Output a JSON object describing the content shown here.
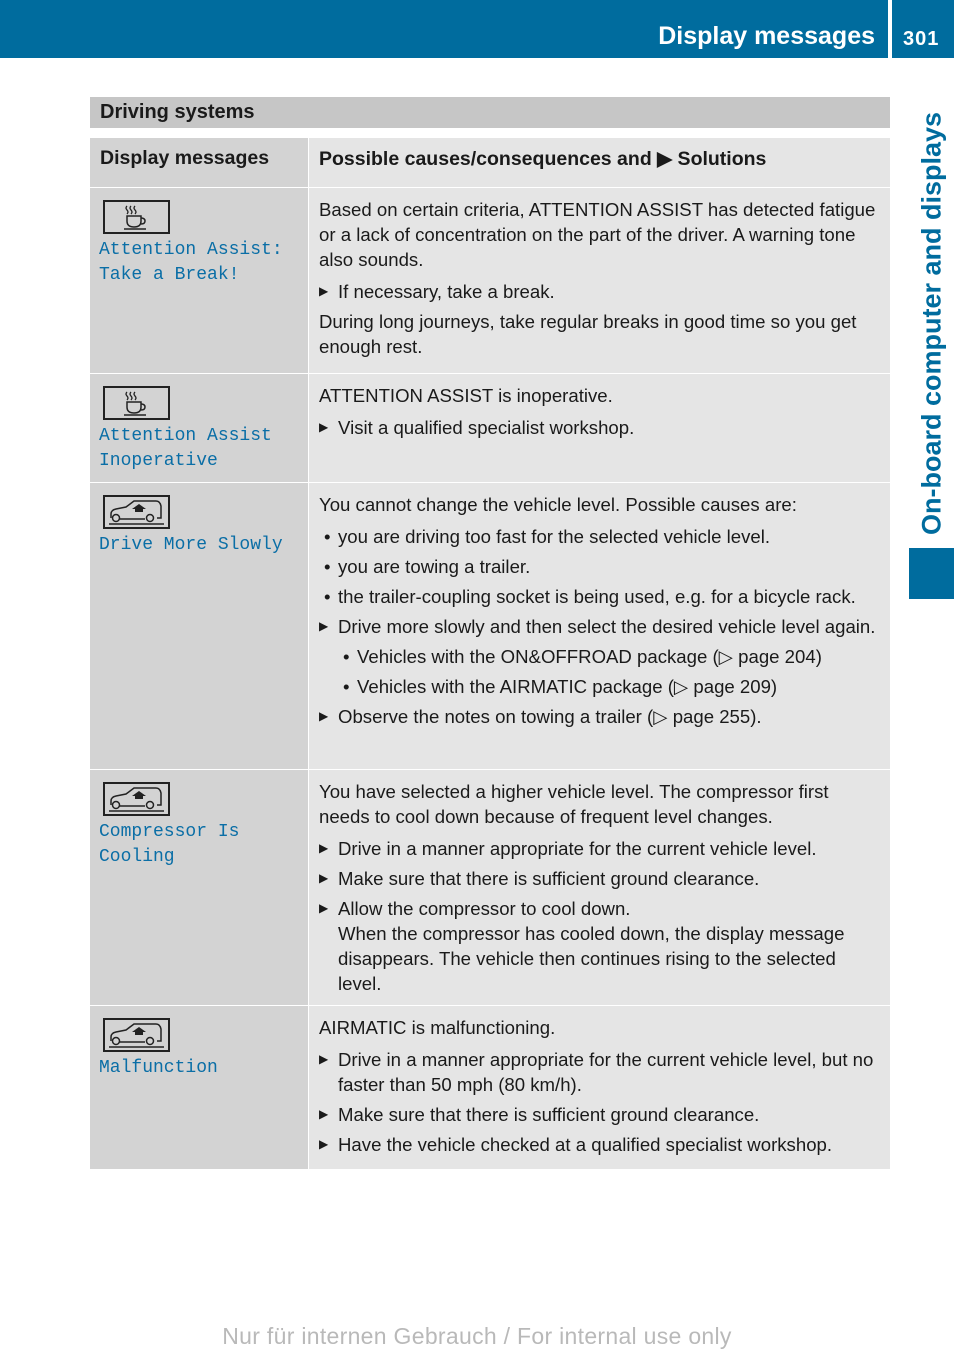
{
  "header": {
    "title": "Display messages",
    "page_number": "301",
    "side_tab": "On-board computer and displays",
    "accent_color": "#006c9e"
  },
  "section": {
    "title": "Driving systems"
  },
  "table": {
    "headers": [
      "Display messages",
      "Possible causes/consequences and ▶ Solutions"
    ],
    "rows": [
      {
        "icon": "coffee-cup-icon",
        "message": "Attention Assist:\nTake a Break!",
        "content": [
          {
            "type": "p",
            "text": "Based on certain criteria, ATTENTION ASSIST has detected fatigue or a lack of concentration on the part of the driver. A warning tone also sounds."
          },
          {
            "type": "step",
            "text": "If necessary, take a break."
          },
          {
            "type": "p",
            "text": "During long journeys, take regular breaks in good time so you get enough rest."
          }
        ]
      },
      {
        "icon": "coffee-cup-icon",
        "message": "Attention Assist\nInoperative",
        "content": [
          {
            "type": "p",
            "text": "ATTENTION ASSIST is inoperative."
          },
          {
            "type": "step",
            "text": "Visit a qualified specialist workshop."
          }
        ]
      },
      {
        "icon": "vehicle-level-icon",
        "message": "Drive More Slowly",
        "content": [
          {
            "type": "p",
            "text": "You cannot change the vehicle level. Possible causes are:"
          },
          {
            "type": "bullet",
            "text": "you are driving too fast for the selected vehicle level."
          },
          {
            "type": "bullet",
            "text": "you are towing a trailer."
          },
          {
            "type": "bullet",
            "text": "the trailer-coupling socket is being used, e.g. for a bicycle rack."
          },
          {
            "type": "step",
            "text": "Drive more slowly and then select the desired vehicle level again."
          },
          {
            "type": "sub",
            "text": "Vehicles with the ON&OFFROAD package (▷ page 204)"
          },
          {
            "type": "sub",
            "text": "Vehicles with the AIRMATIC package (▷ page 209)"
          },
          {
            "type": "step",
            "text": "Observe the notes on towing a trailer (▷ page 255)."
          }
        ]
      },
      {
        "icon": "vehicle-level-icon",
        "message": "Compressor Is\nCooling",
        "content": [
          {
            "type": "p",
            "text": "You have selected a higher vehicle level. The compressor first needs to cool down because of frequent level changes."
          },
          {
            "type": "step",
            "text": "Drive in a manner appropriate for the current vehicle level."
          },
          {
            "type": "step",
            "text": "Make sure that there is sufficient ground clearance."
          },
          {
            "type": "step",
            "text": "Allow the compressor to cool down."
          },
          {
            "type": "cont",
            "text": "When the compressor has cooled down, the display message disappears. The vehicle then continues rising to the selected level."
          }
        ]
      },
      {
        "icon": "vehicle-level-icon",
        "message": "Malfunction",
        "content": [
          {
            "type": "p",
            "text": "AIRMATIC is malfunctioning."
          },
          {
            "type": "step",
            "text": "Drive in a manner appropriate for the current vehicle level, but no faster than 50 mph (80 km/h)."
          },
          {
            "type": "step",
            "text": "Make sure that there is sufficient ground clearance."
          },
          {
            "type": "step",
            "text": "Have the vehicle checked at a qualified specialist workshop."
          }
        ]
      }
    ]
  },
  "footer": {
    "watermark": "Nur für internen Gebrauch / For internal use only"
  }
}
